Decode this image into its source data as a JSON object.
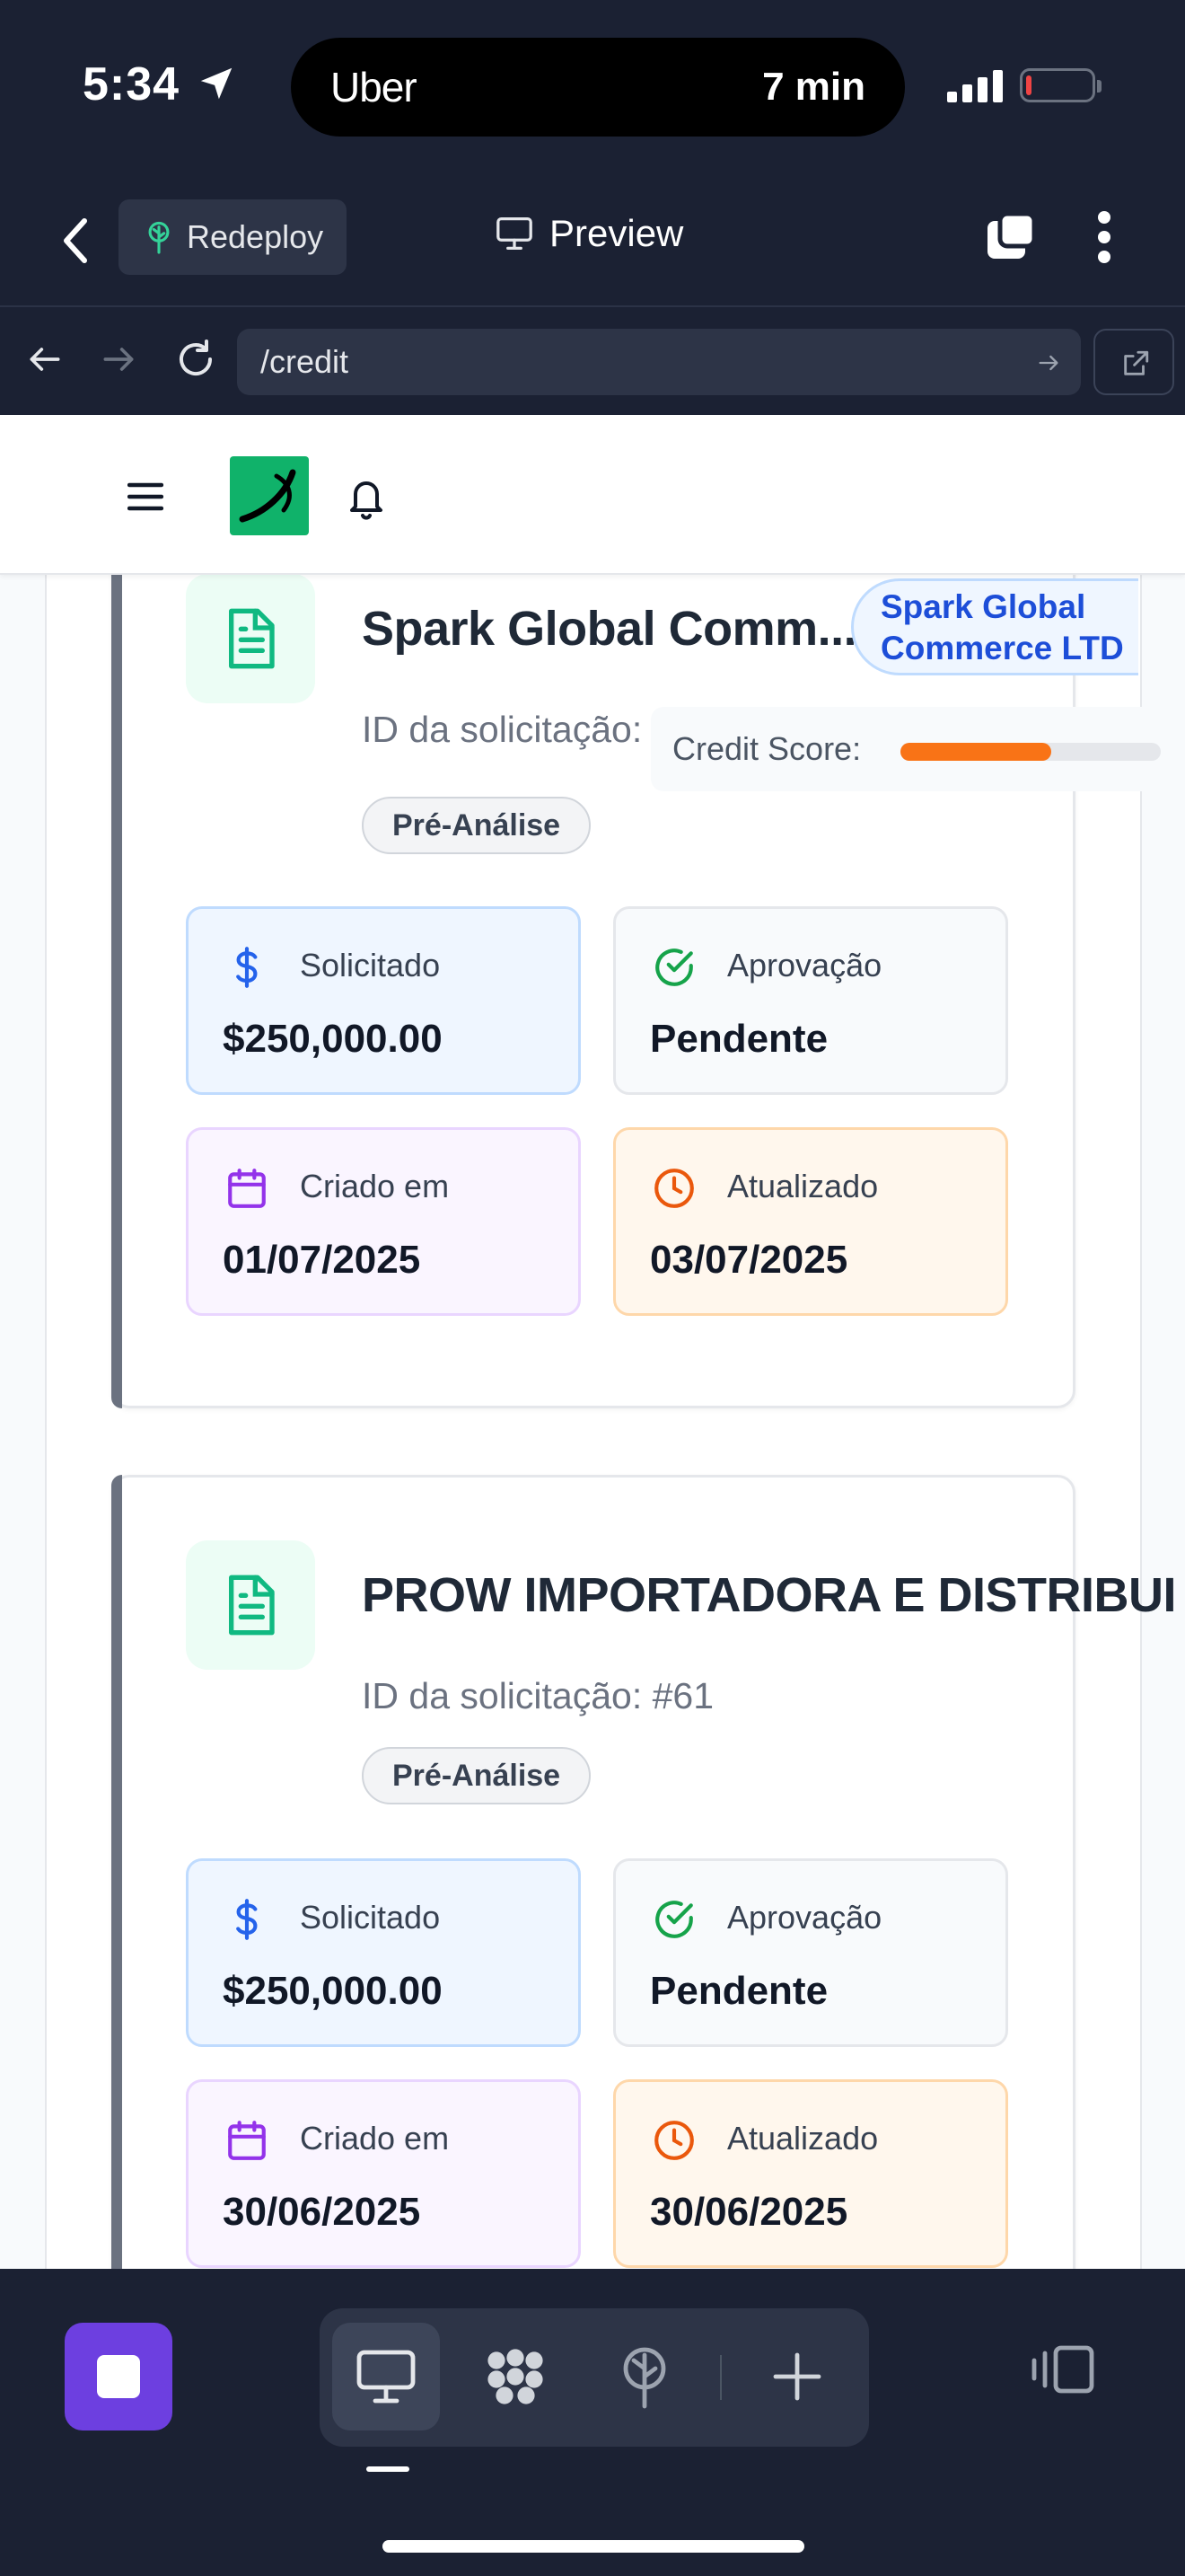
{
  "status_bar": {
    "time": "5:34",
    "island_app": "Uber",
    "island_eta": "7 min"
  },
  "editor_header": {
    "redeploy_label": "Redeploy",
    "preview_label": "Preview"
  },
  "url_bar": {
    "path": "/credit"
  },
  "cards": [
    {
      "company": "Spark Global Comm...",
      "company_badge": [
        "Spark Global",
        "Commerce LTD"
      ],
      "request_id": "ID da solicitação: #62",
      "status": "Pré-Análise",
      "credit_score_label": "Credit Score:",
      "credit_score_fill": 0.58,
      "metrics": {
        "requested_label": "Solicitado",
        "requested_value": "$250,000.00",
        "approval_label": "Aprovação",
        "approval_value": "Pendente",
        "created_label": "Criado em",
        "created_value": "01/07/2025",
        "updated_label": "Atualizado",
        "updated_value": "03/07/2025"
      }
    },
    {
      "company": "PROW IMPORTADORA E DISTRIBUI",
      "request_id": "ID da solicitação: #61",
      "status": "Pré-Análise",
      "metrics": {
        "requested_label": "Solicitado",
        "requested_value": "$250,000.00",
        "approval_label": "Aprovação",
        "approval_value": "Pendente",
        "created_label": "Criado em",
        "created_value": "30/06/2025",
        "updated_label": "Atualizado",
        "updated_value": "30/06/2025"
      }
    }
  ],
  "colors": {
    "chrome_bg": "#1b2133",
    "accent_purple": "#6d3fe0",
    "logo_green": "#10b26a",
    "score_orange": "#f97316"
  }
}
